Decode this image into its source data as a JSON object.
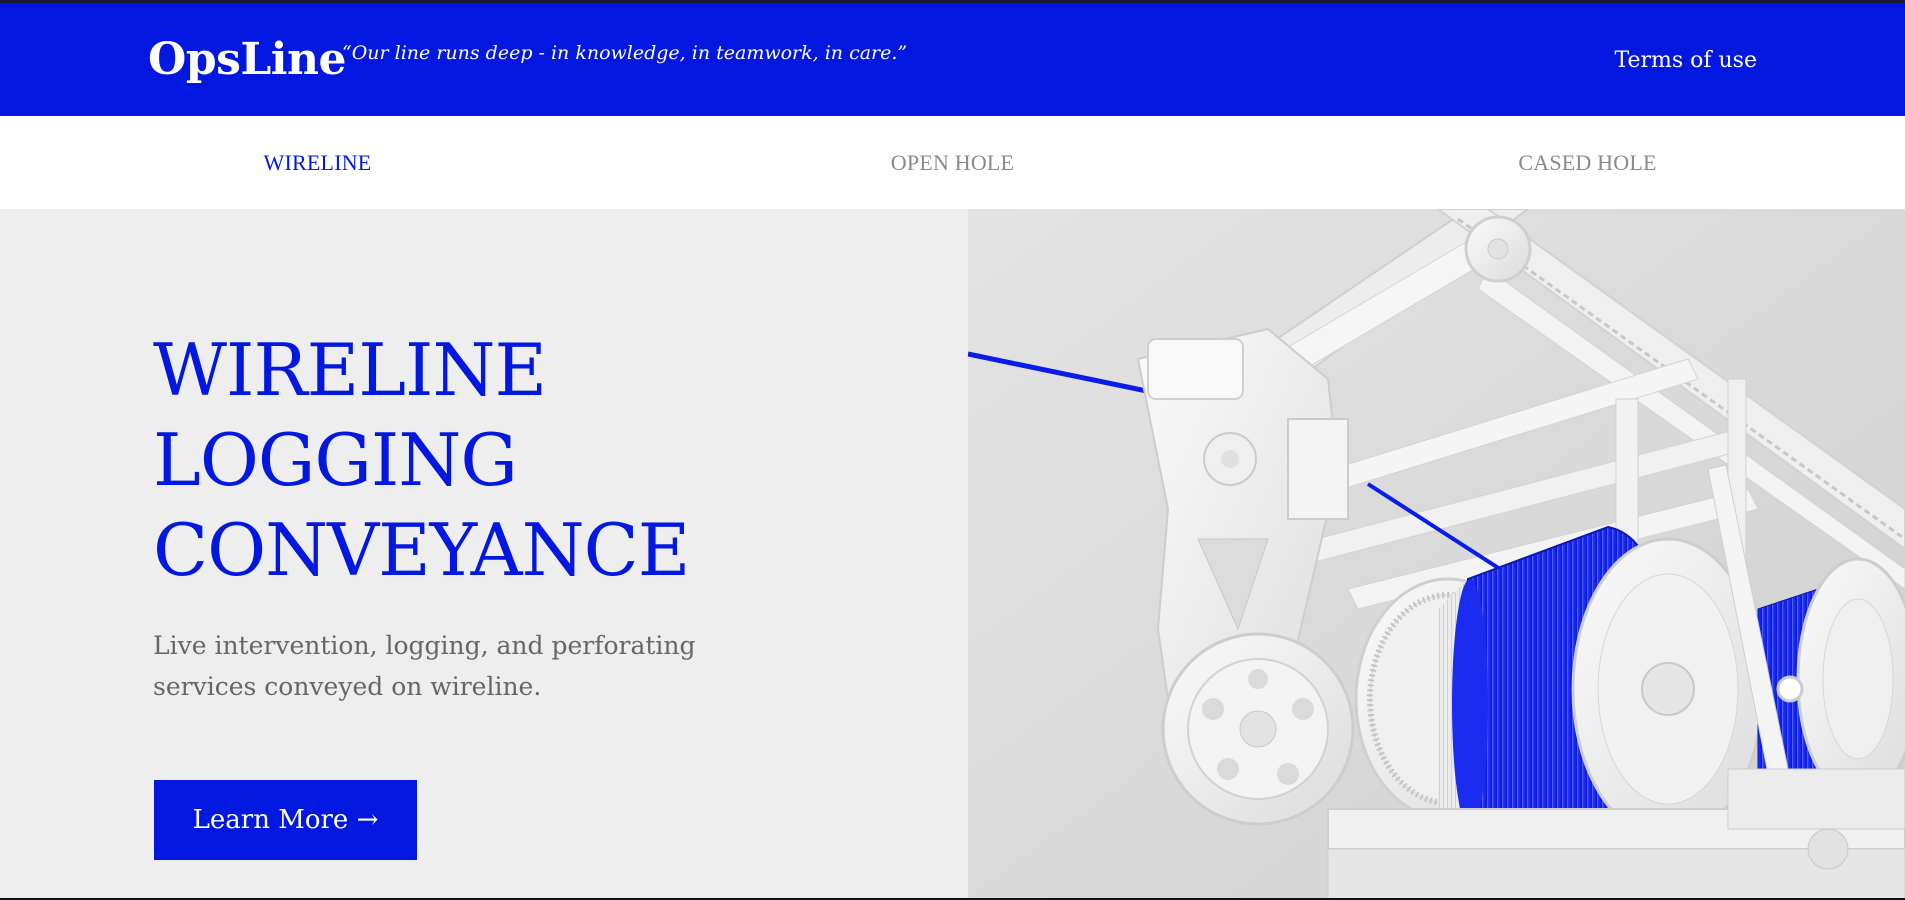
{
  "header": {
    "logo": "OpsLine",
    "tagline": "“Our line runs deep - in knowledge, in teamwork, in care.”",
    "terms_link": "Terms of use"
  },
  "tabs": [
    {
      "label": "WIRELINE",
      "active": true
    },
    {
      "label": "OPEN HOLE",
      "active": false
    },
    {
      "label": "CASED HOLE",
      "active": false
    }
  ],
  "hero": {
    "title_lines": [
      "WIRELINE",
      "LOGGING",
      "CONVEYANCE"
    ],
    "subtitle": "Live intervention, logging, and perforating services conveyed on wireline.",
    "button_label": "Learn More →",
    "image_name": "wireline-winch-illustration"
  },
  "colors": {
    "brand_blue": "#0218e0",
    "hero_bg": "#eeeeee",
    "tab_inactive": "#8a8a8a",
    "subtitle_gray": "#666666"
  }
}
